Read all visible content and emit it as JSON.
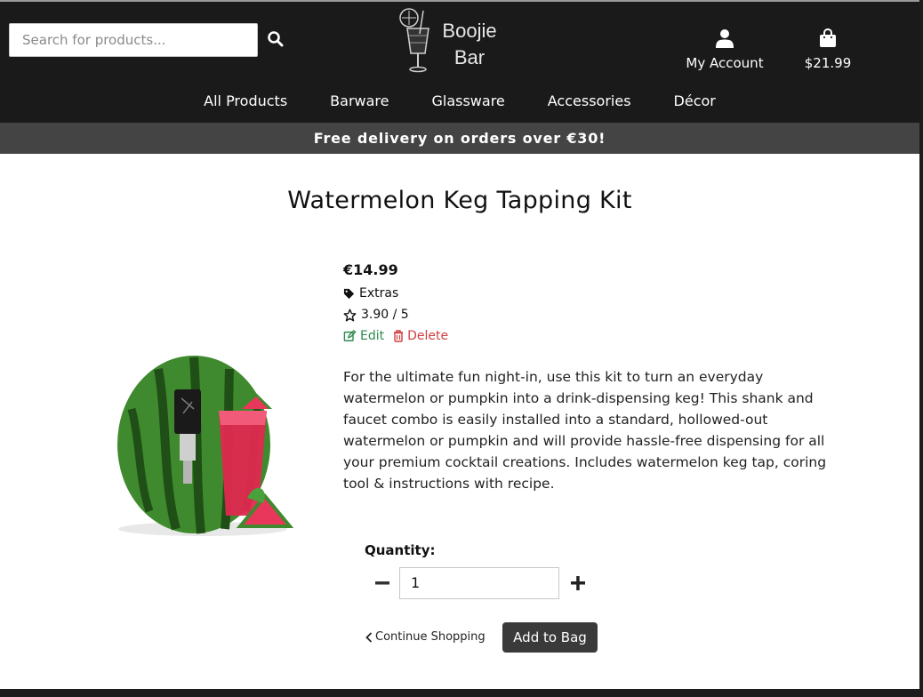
{
  "header": {
    "search": {
      "placeholder": "Search for products..."
    },
    "logo": {
      "line1": "Boojie",
      "line2": "Bar"
    },
    "account_label": "My Account",
    "bag_total": "$21.99",
    "icons": {
      "search": "search-icon",
      "account": "user-icon",
      "bag": "shopping-bag-icon"
    }
  },
  "nav": {
    "items": [
      {
        "label": "All Products"
      },
      {
        "label": "Barware"
      },
      {
        "label": "Glassware"
      },
      {
        "label": "Accessories"
      },
      {
        "label": "Décor"
      }
    ]
  },
  "promo": {
    "text": "Free delivery on orders over €30!"
  },
  "product": {
    "title": "Watermelon Keg Tapping Kit",
    "price": "€14.99",
    "category": "Extras",
    "rating": "3.90 / 5",
    "edit_label": "Edit",
    "delete_label": "Delete",
    "description": "For the ultimate fun night-in, use this kit to turn an everyday watermelon or pumpkin into a drink-dispensing keg! This shank and faucet combo is easily installed into a standard, hollowed-out watermelon or pumpkin and will provide hassle-free dispensing for all your premium cocktail creations. Includes watermelon keg tap, coring tool & instructions with recipe."
  },
  "purchase": {
    "quantity_label": "Quantity:",
    "quantity_value": "1",
    "continue_label": "Continue Shopping",
    "add_label": "Add to Bag"
  },
  "colors": {
    "header_bg": "#1a1a1a",
    "promo_bg": "#444444",
    "edit": "#2d8a4e",
    "delete": "#d23d3d",
    "button_bg": "#3a3a3a"
  }
}
